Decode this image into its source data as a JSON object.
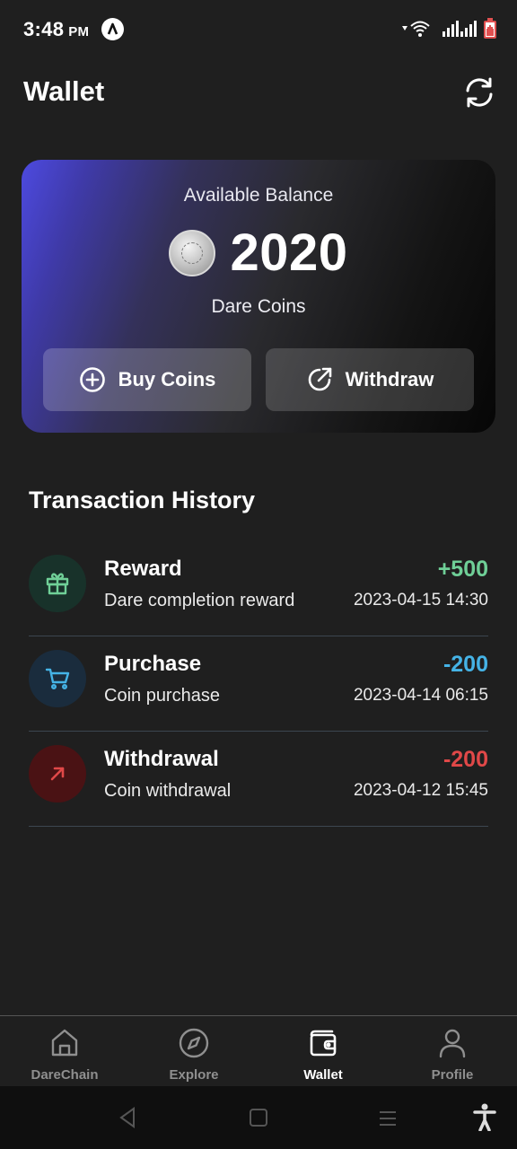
{
  "status_bar": {
    "time": "3:48",
    "ampm": "PM"
  },
  "header": {
    "title": "Wallet"
  },
  "balance_card": {
    "label": "Available Balance",
    "amount": "2020",
    "unit": "Dare Coins",
    "buy_label": "Buy Coins",
    "withdraw_label": "Withdraw"
  },
  "transactions": {
    "title": "Transaction History",
    "items": [
      {
        "title": "Reward",
        "subtitle": "Dare completion reward",
        "amount": "+500",
        "date": "2023-04-15 14:30",
        "icon": "gift-icon",
        "color": "#6fcf97",
        "bg": "#18322a"
      },
      {
        "title": "Purchase",
        "subtitle": "Coin purchase",
        "amount": "-200",
        "date": "2023-04-14 06:15",
        "icon": "cart-icon",
        "color": "#45b3e6",
        "bg": "#1a2c3d"
      },
      {
        "title": "Withdrawal",
        "subtitle": "Coin withdrawal",
        "amount": "-200",
        "date": "2023-04-12 15:45",
        "icon": "arrow-up-right-icon",
        "color": "#e04848",
        "bg": "#4a1214"
      }
    ]
  },
  "bottom_nav": {
    "items": [
      {
        "label": "DareChain",
        "icon": "home-icon"
      },
      {
        "label": "Explore",
        "icon": "compass-icon"
      },
      {
        "label": "Wallet",
        "icon": "wallet-icon"
      },
      {
        "label": "Profile",
        "icon": "user-icon"
      }
    ],
    "active": "Wallet"
  }
}
